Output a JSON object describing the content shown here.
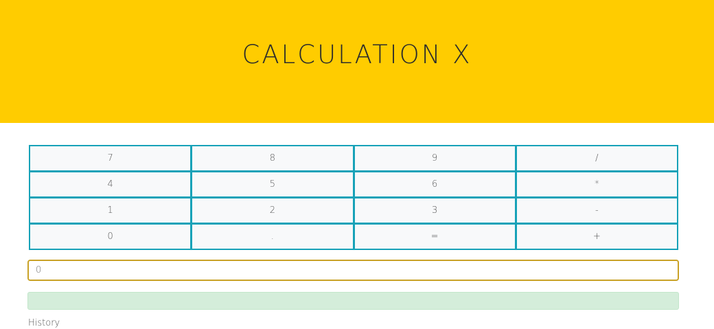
{
  "header": {
    "title": "CALCULATION X",
    "background_color": "#ffcc00"
  },
  "keypad": {
    "border_color": "#17a2b8",
    "keys": [
      {
        "label": "7"
      },
      {
        "label": "8"
      },
      {
        "label": "9"
      },
      {
        "label": "/"
      },
      {
        "label": "4"
      },
      {
        "label": "5"
      },
      {
        "label": "6"
      },
      {
        "label": "*"
      },
      {
        "label": "1"
      },
      {
        "label": "2"
      },
      {
        "label": "3"
      },
      {
        "label": "-"
      },
      {
        "label": "0"
      },
      {
        "label": "."
      },
      {
        "label": "="
      },
      {
        "label": "+"
      }
    ]
  },
  "display": {
    "placeholder": "0",
    "value": ""
  },
  "result": {
    "text": "",
    "background_color": "#d4edda"
  },
  "history": {
    "label": "History"
  }
}
